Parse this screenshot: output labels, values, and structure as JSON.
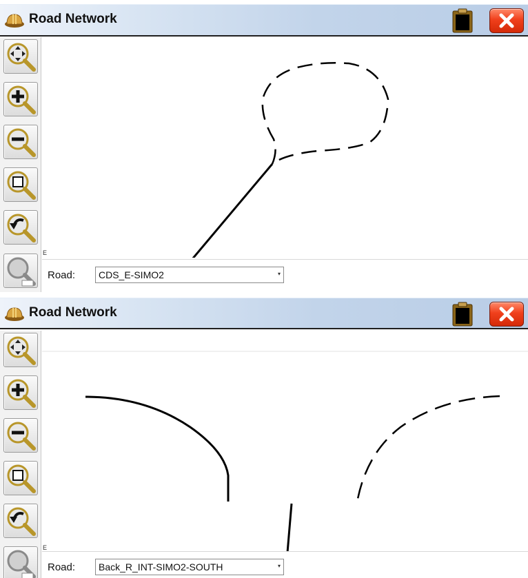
{
  "windows": [
    {
      "title": "Road Network",
      "road_label": "Road:",
      "road_value": "CDS_E-SIMO2"
    },
    {
      "title": "Road Network",
      "road_label": "Road:",
      "road_value": "Back_R_INT-SIMO2-SOUTH"
    }
  ],
  "toolbar_icons": [
    "pan-icon",
    "zoom-in-icon",
    "zoom-out-icon",
    "zoom-extents-icon",
    "zoom-previous-icon",
    "zoom-window-icon"
  ],
  "origin_label": "E",
  "colors": {
    "titlebar": "#c2d4ea",
    "close_button": "#e8401c",
    "road_line": "#000000"
  }
}
